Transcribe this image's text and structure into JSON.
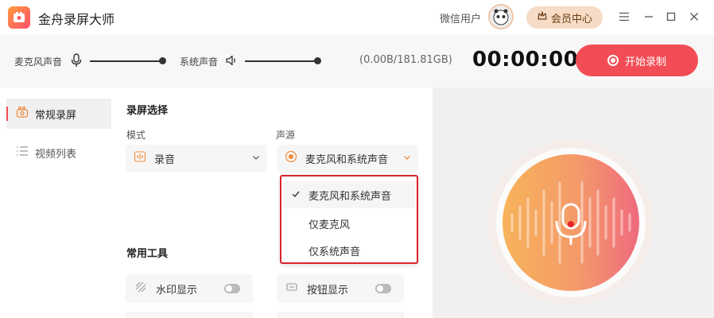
{
  "app": {
    "title": "金舟录屏大师"
  },
  "header": {
    "user_name": "微信用户",
    "vip_label": "会员中心"
  },
  "toolbar": {
    "mic_label": "麦克风声音",
    "sys_label": "系统声音",
    "disk_usage": "(0.00B/181.81GB)",
    "timer": "00:00:00",
    "record_label": "开始录制"
  },
  "sidebar": {
    "items": [
      {
        "label": "常规录屏",
        "active": true
      },
      {
        "label": "视频列表",
        "active": false
      }
    ]
  },
  "main": {
    "section_record": "录屏选择",
    "mode_label": "模式",
    "mode_value": "录音",
    "source_label": "声源",
    "source_value": "麦克风和系统声音",
    "source_options": [
      "麦克风和系统声音",
      "仅麦克风",
      "仅系统声音"
    ],
    "source_selected_index": 0,
    "section_tools": "常用工具",
    "tools": [
      {
        "label": "水印显示",
        "on": false
      },
      {
        "label": "按钮显示",
        "on": false
      }
    ]
  },
  "colors": {
    "accent": "#f24d56",
    "highlight_border": "#d9242b",
    "vip_bg": "#f6dcc6"
  },
  "icons": [
    "app-logo-icon",
    "mic-icon",
    "speaker-icon",
    "crown-icon",
    "menu-icon",
    "minimize-icon",
    "maximize-icon",
    "close-icon",
    "record-icon",
    "audio-mode-icon",
    "source-icon",
    "chevron-down-icon",
    "check-icon",
    "watermark-icon",
    "button-icon"
  ]
}
